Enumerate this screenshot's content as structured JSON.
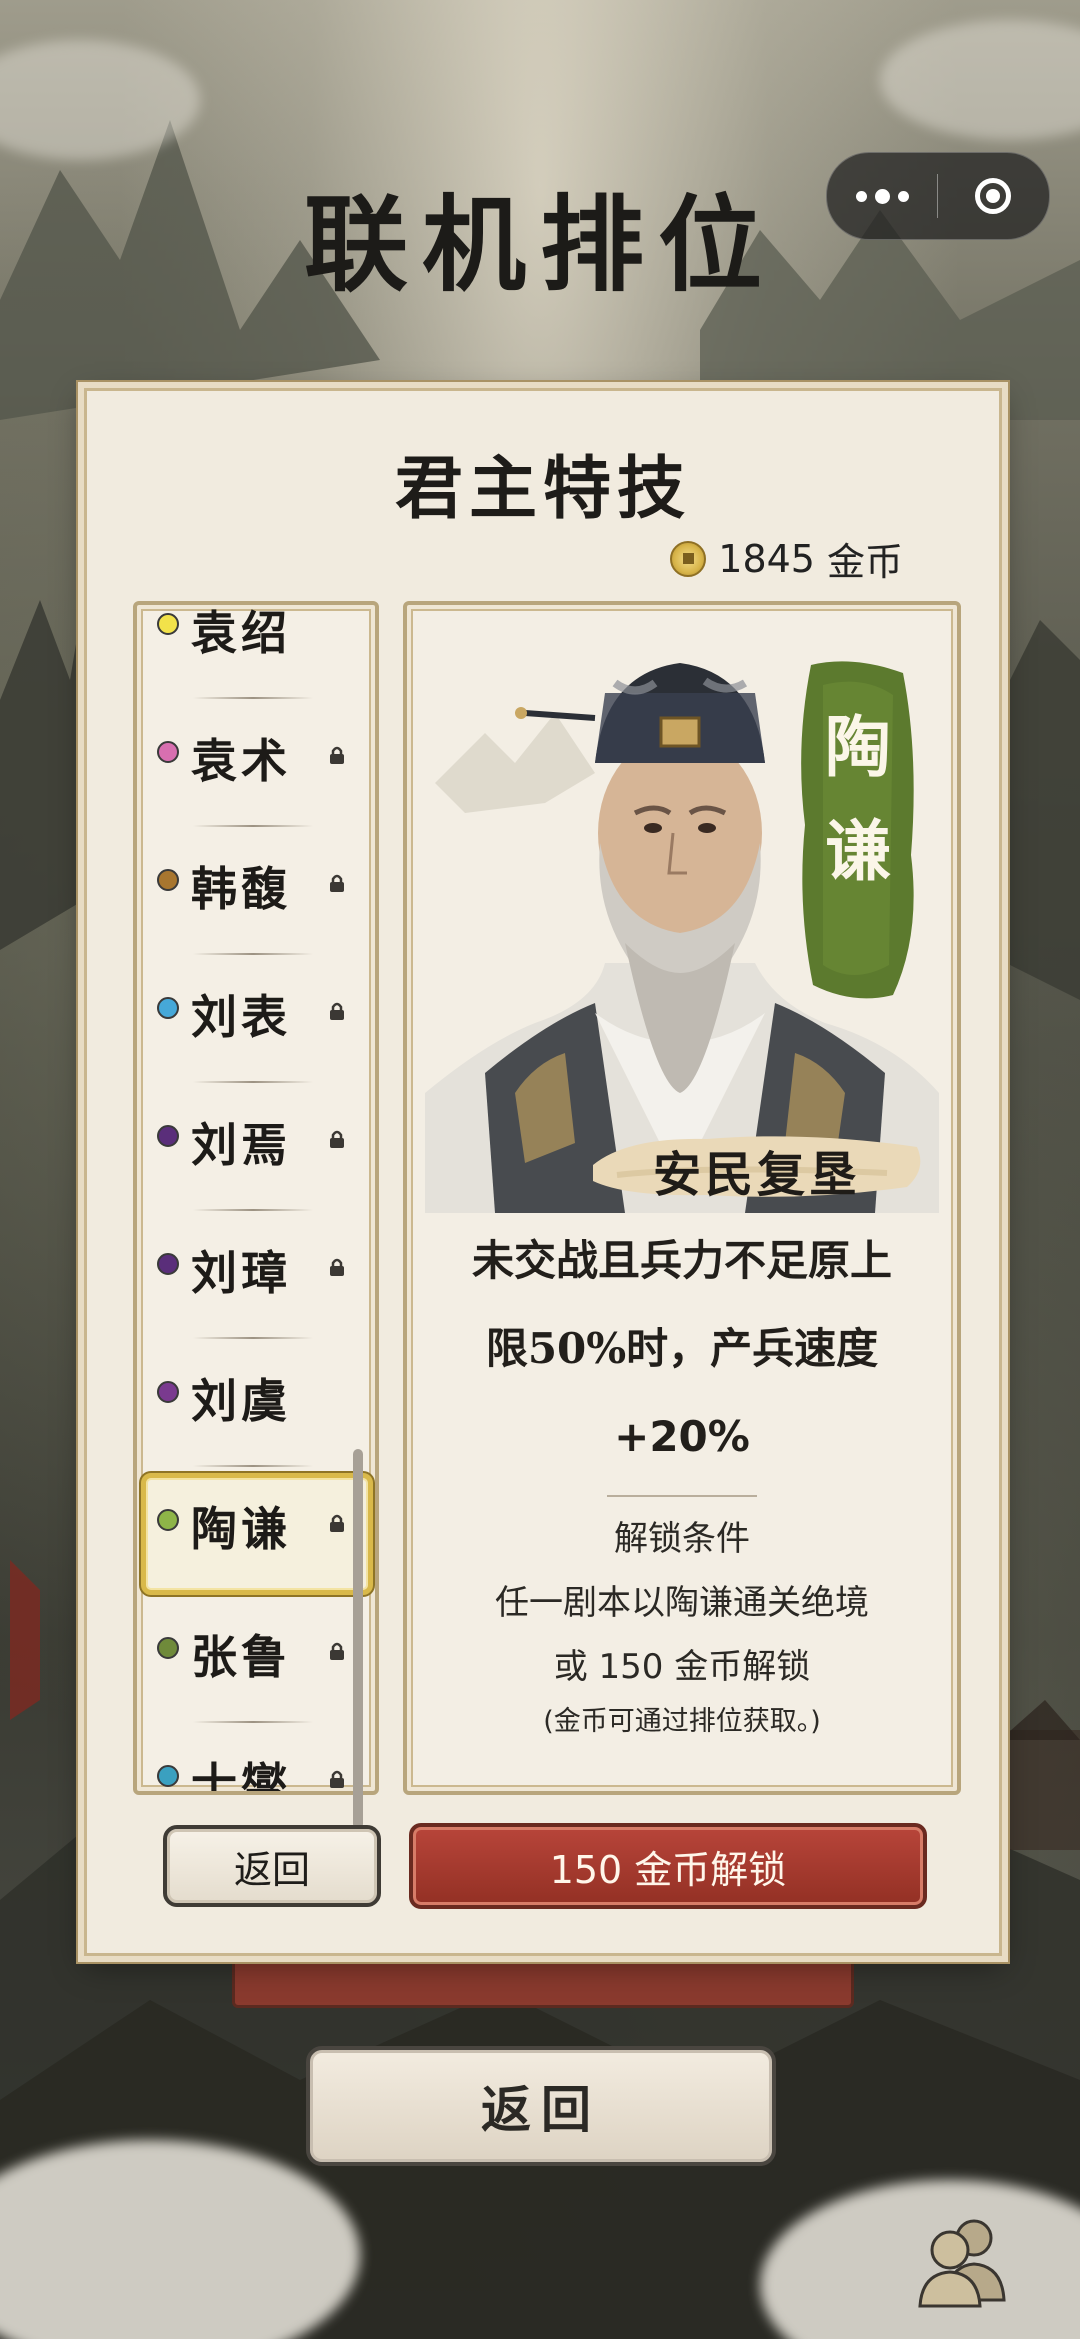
{
  "header": {
    "title": "联机排位"
  },
  "dialog": {
    "title": "君主特技",
    "coins": {
      "amount": "1845",
      "unit": "金币"
    },
    "lords": [
      {
        "name": "袁绍",
        "color": "#f2e24a",
        "locked": false,
        "selected": false
      },
      {
        "name": "袁术",
        "color": "#d86fb0",
        "locked": true,
        "selected": false
      },
      {
        "name": "韩馥",
        "color": "#a8762f",
        "locked": true,
        "selected": false
      },
      {
        "name": "刘表",
        "color": "#46a8d8",
        "locked": true,
        "selected": false
      },
      {
        "name": "刘焉",
        "color": "#5a2e7a",
        "locked": true,
        "selected": false
      },
      {
        "name": "刘璋",
        "color": "#5a2e7a",
        "locked": true,
        "selected": false
      },
      {
        "name": "刘虞",
        "color": "#7a3a8f",
        "locked": false,
        "selected": false
      },
      {
        "name": "陶谦",
        "color": "#8eb548",
        "locked": true,
        "selected": true
      },
      {
        "name": "张鲁",
        "color": "#6f8a3a",
        "locked": true,
        "selected": false
      },
      {
        "name": "士燮",
        "color": "#3aa0c0",
        "locked": true,
        "selected": false
      }
    ],
    "detail": {
      "lord_name": "陶谦",
      "banner_color": "#5c7a2e",
      "skill_name": "安民复垦",
      "description_line1": "未交战且兵力不足原上",
      "description_line2": "限50%时，产兵速度",
      "description_line3": "+20%",
      "unlock_title": "解锁条件",
      "unlock_condition": "任一剧本以陶谦通关绝境",
      "unlock_cost": "或 150 金币解锁",
      "unlock_note": "(金币可通过排位获取。)"
    },
    "buttons": {
      "back": "返回",
      "unlock": "150 金币解锁"
    }
  },
  "footer": {
    "back_label": "返回"
  },
  "icons": {
    "more": "more-dots-icon",
    "close": "target-close-icon",
    "coin": "coin-icon",
    "lock": "lock-icon",
    "people": "people-icon"
  }
}
